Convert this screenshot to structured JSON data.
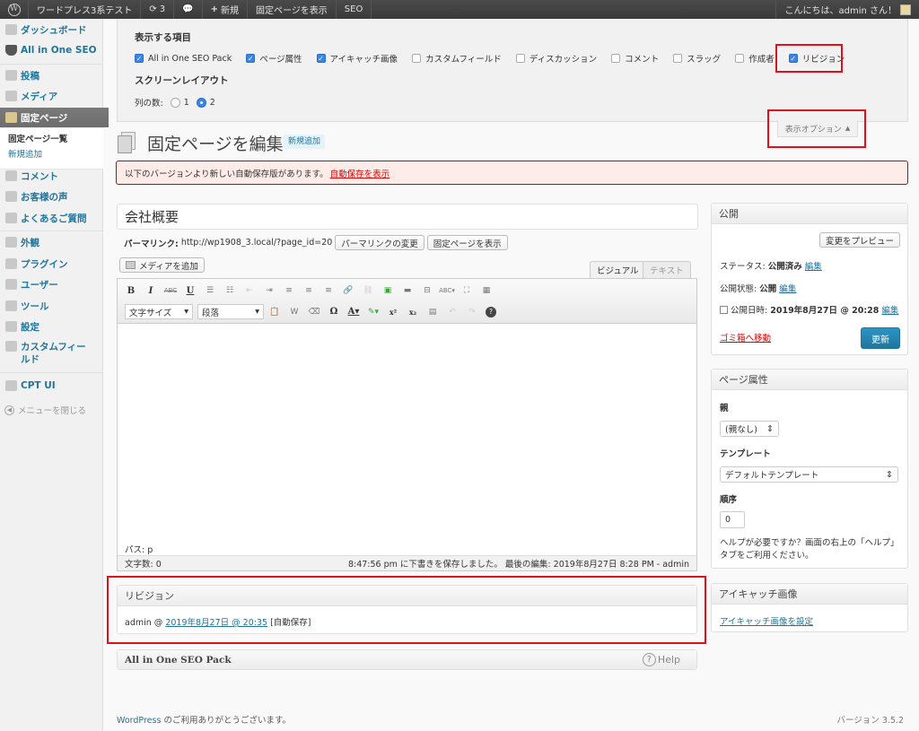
{
  "adminbar": {
    "site_name": "ワードプレス3系テスト",
    "updates_count": "3",
    "new_label": "新規",
    "view_page": "固定ページを表示",
    "seo": "SEO",
    "greeting": "こんにちは、admin さん！"
  },
  "sidebar": {
    "items": [
      {
        "label": "ダッシュボード"
      },
      {
        "label": "All in One SEO"
      },
      {
        "label": "投稿"
      },
      {
        "label": "メディア"
      },
      {
        "label": "固定ページ"
      },
      {
        "label": "コメント"
      },
      {
        "label": "お客様の声"
      },
      {
        "label": "よくあるご質問"
      },
      {
        "label": "外観"
      },
      {
        "label": "プラグイン"
      },
      {
        "label": "ユーザー"
      },
      {
        "label": "ツール"
      },
      {
        "label": "設定"
      },
      {
        "label": "カスタムフィールド"
      },
      {
        "label": "CPT UI"
      }
    ],
    "submenu": {
      "current": "固定ページ一覧",
      "add_new": "新規追加"
    },
    "collapse": "メニューを閉じる"
  },
  "screen_options": {
    "heading": "表示する項目",
    "checkboxes": [
      {
        "label": "All in One SEO Pack",
        "checked": true
      },
      {
        "label": "ページ属性",
        "checked": true
      },
      {
        "label": "アイキャッチ画像",
        "checked": true
      },
      {
        "label": "カスタムフィールド",
        "checked": false
      },
      {
        "label": "ディスカッション",
        "checked": false
      },
      {
        "label": "コメント",
        "checked": false
      },
      {
        "label": "スラッグ",
        "checked": false
      },
      {
        "label": "作成者",
        "checked": false
      },
      {
        "label": "リビジョン",
        "checked": true
      }
    ],
    "layout_heading": "スクリーンレイアウト",
    "columns_label": "列の数:",
    "column_options": [
      "1",
      "2"
    ],
    "selected_columns": "2",
    "toggle_label": "表示オプション"
  },
  "page": {
    "title": "固定ページを編集",
    "add_new": "新規追加",
    "notice_text": "以下のバージョンより新しい自動保存版があります。",
    "notice_link": "自動保存を表示"
  },
  "editor": {
    "post_title": "会社概要",
    "permalink_label": "パーマリンク:",
    "permalink_url": "http://wp1908_3.local/?page_id=20",
    "change_permalink": "パーマリンクの変更",
    "view_page": "固定ページを表示",
    "add_media": "メディアを追加",
    "tab_visual": "ビジュアル",
    "tab_text": "テキスト",
    "font_size": "文字サイズ",
    "paragraph": "段落",
    "path": "パス: p",
    "word_count": "文字数: 0",
    "save_status": "8:47:56 pm に下書きを保存しました。 最後の編集: 2019年8月27日 8:28 PM - admin"
  },
  "revisions": {
    "title": "リビジョン",
    "author": "admin @",
    "link": "2019年8月27日 @ 20:35",
    "note": "[自動保存]"
  },
  "aioseo": {
    "title": "All in One SEO Pack",
    "help": "Help"
  },
  "publish": {
    "title": "公開",
    "preview": "変更をプレビュー",
    "status_label": "ステータス:",
    "status_value": "公開済み",
    "visibility_label": "公開状態:",
    "visibility_value": "公開",
    "date_label": "公開日時:",
    "date_value": "2019年8月27日 @ 20:28",
    "edit": "編集",
    "trash": "ゴミ箱へ移動",
    "update": "更新"
  },
  "page_attributes": {
    "title": "ページ属性",
    "parent_label": "親",
    "parent_value": "(親なし)",
    "template_label": "テンプレート",
    "template_value": "デフォルトテンプレート",
    "order_label": "順序",
    "order_value": "0",
    "help": "ヘルプが必要ですか？画面の右上の「ヘルプ」タブをご利用ください。"
  },
  "featured_image": {
    "title": "アイキャッチ画像",
    "link": "アイキャッチ画像を設定"
  },
  "footer": {
    "wordpress": "WordPress",
    "thanks": " のご利用ありがとうございます。",
    "version": "バージョン 3.5.2"
  },
  "colors": {
    "highlight": "#e0101a",
    "link": "#21759b",
    "primary_button": "#21759b"
  }
}
